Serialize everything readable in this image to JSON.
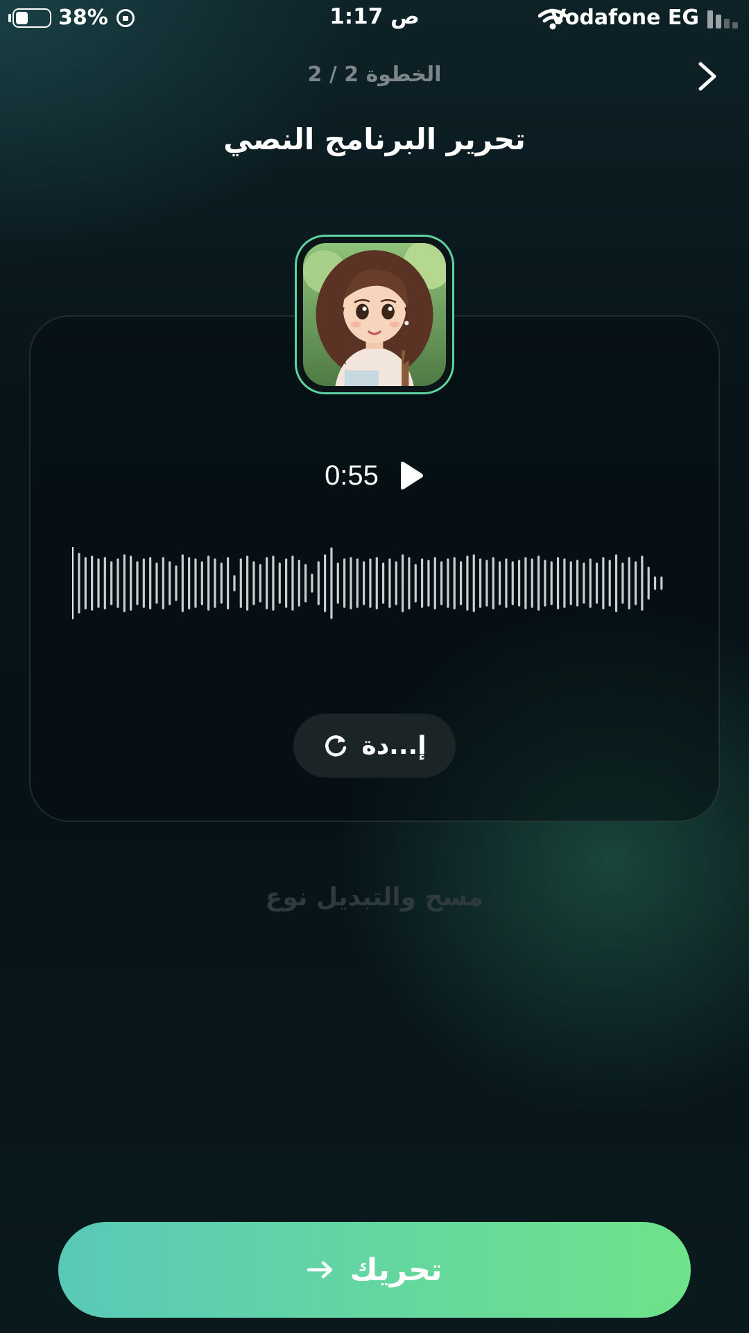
{
  "status_bar": {
    "battery_percent": "38%",
    "battery_level": 0.38,
    "time": "1:17 ص",
    "carrier": "Vodafone EG"
  },
  "header": {
    "step": "الخطوة 2 / 2",
    "title": "تحرير البرنامج النصي"
  },
  "player": {
    "duration": "0:55",
    "redo_label": "إ...دة"
  },
  "clear_link": "مسح والتبديل نوع",
  "cta": {
    "label": "تحريك"
  },
  "colors": {
    "accent": "#5fd3a2",
    "cta_start": "#59c9b8",
    "cta_end": "#6ee38a"
  },
  "icons": [
    "lock-rotation-icon",
    "wifi-icon",
    "signal-icon",
    "chevron-right-icon",
    "play-icon",
    "refresh-icon",
    "arrow-right-icon"
  ]
}
